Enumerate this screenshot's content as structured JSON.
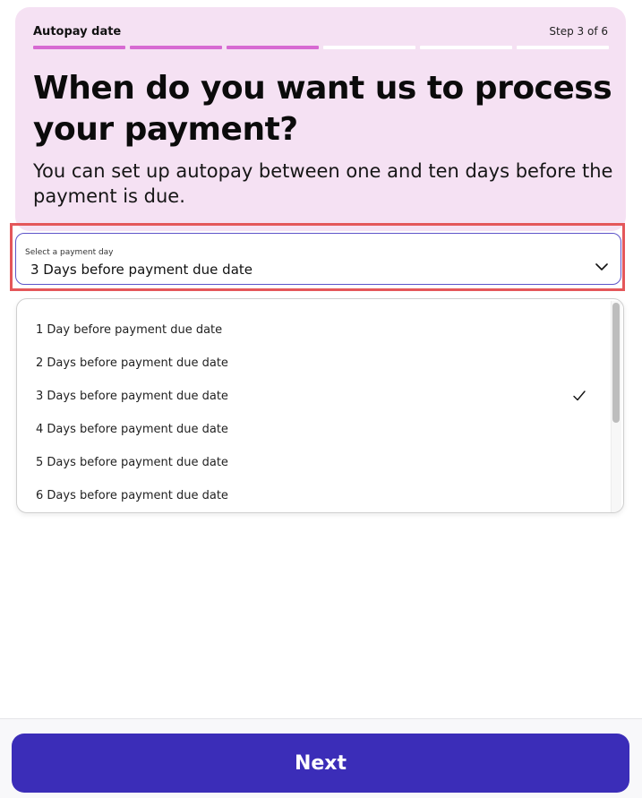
{
  "header": {
    "step_label": "Autopay date",
    "step_count": "Step 3 of 6",
    "progress": {
      "completed": 3,
      "total": 6
    },
    "headline": "When do you want us to process your payment?",
    "subtext": "You can set up autopay between one and ten days before the payment is due."
  },
  "select": {
    "caption": "Select a payment day",
    "value": "3 Days before payment due date"
  },
  "dropdown": {
    "options": [
      {
        "label": "1 Day before payment due date",
        "selected": false
      },
      {
        "label": "2 Days before payment due date",
        "selected": false
      },
      {
        "label": "3 Days before payment due date",
        "selected": true
      },
      {
        "label": "4 Days before payment due date",
        "selected": false
      },
      {
        "label": "5 Days before payment due date",
        "selected": false
      },
      {
        "label": "6 Days before payment due date",
        "selected": false
      }
    ]
  },
  "footer": {
    "next_label": "Next"
  },
  "colors": {
    "header_bg": "#f5e1f3",
    "progress_done": "#d76ad2",
    "accent": "#3b2db8",
    "highlight": "#e4575a"
  },
  "icons": {
    "chevron": "chevron-down-icon",
    "check": "check-icon"
  }
}
